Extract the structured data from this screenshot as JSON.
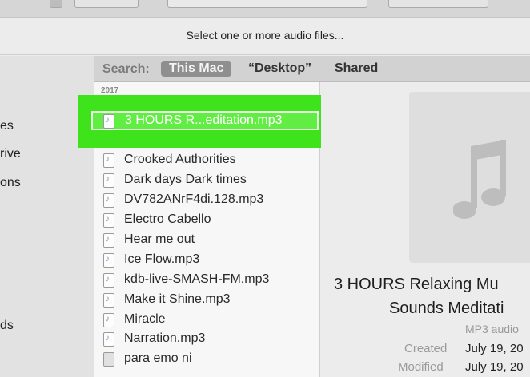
{
  "dialog": {
    "prompt": "Select one or more audio files..."
  },
  "sidebar": {
    "items": [
      {
        "label": "es"
      },
      {
        "label": "rive"
      },
      {
        "label": "ons"
      },
      {
        "label": "ds"
      }
    ]
  },
  "search": {
    "label": "Search:",
    "scopes": [
      {
        "label": "This Mac",
        "active": true
      },
      {
        "label": "“Desktop”",
        "active": false
      },
      {
        "label": "Shared",
        "active": false
      }
    ]
  },
  "filelist": {
    "group_header": "2017",
    "selected": {
      "name": "3 HOURS R...editation.mp3"
    },
    "items": [
      {
        "name": "Crooked Authorities",
        "icon": "audio-file-icon"
      },
      {
        "name": "Dark days Dark times",
        "icon": "audio-file-icon"
      },
      {
        "name": "DV782ANrF4di.128.mp3",
        "icon": "audio-file-icon"
      },
      {
        "name": "Electro Cabello",
        "icon": "audio-file-icon"
      },
      {
        "name": "Hear me out",
        "icon": "audio-file-icon"
      },
      {
        "name": "Ice Flow.mp3",
        "icon": "audio-file-icon"
      },
      {
        "name": "kdb-live-SMASH-FM.mp3",
        "icon": "audio-file-icon"
      },
      {
        "name": "Make it Shine.mp3",
        "icon": "audio-file-icon"
      },
      {
        "name": "Miracle",
        "icon": "audio-file-icon"
      },
      {
        "name": "Narration.mp3",
        "icon": "audio-file-icon"
      },
      {
        "name": "para emo ni",
        "icon": "generic-file-icon"
      }
    ]
  },
  "preview": {
    "artwork_icon": "music-note-icon",
    "title_line1": "3 HOURS Relaxing Mu",
    "title_line2": "Sounds Meditati",
    "kind": "MP3 audio",
    "created_label": "Created",
    "created_value": "July 19, 20",
    "modified_label": "Modified",
    "modified_value": "July 19, 20"
  },
  "colors": {
    "highlight": "#3ee31c",
    "selected_row": "#62ed44"
  }
}
